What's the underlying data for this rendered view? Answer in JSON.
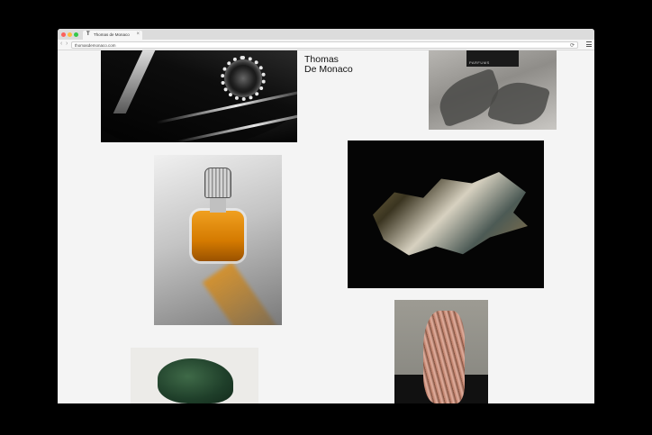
{
  "browser": {
    "tab_title": "Thomas de Monaco",
    "tab_favicon": "T",
    "tab_close": "×",
    "url": "thomasdemonaco.com",
    "reload_glyph": "⟳",
    "back_glyph": "‹",
    "forward_glyph": "›"
  },
  "page": {
    "title_line1": "Thomas",
    "title_line2": "De Monaco"
  },
  "images": {
    "perfume_box_text": "PARFUMS"
  },
  "colors": {
    "page_background": "#f4f4f4",
    "outer_background": "#000000",
    "window_red": "#fc605b",
    "window_yellow": "#fdbc40",
    "window_green": "#34c84a"
  }
}
